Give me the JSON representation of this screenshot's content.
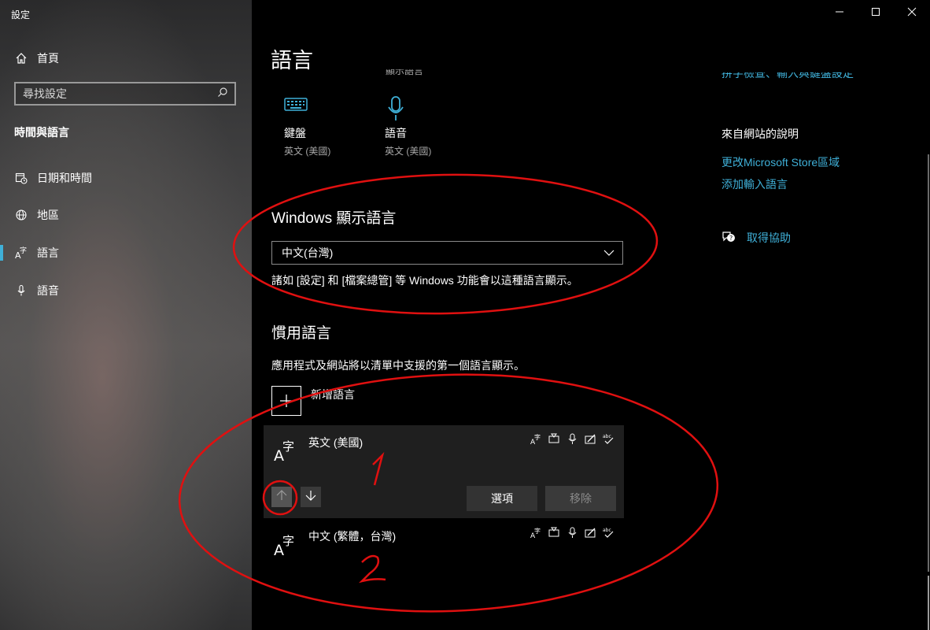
{
  "window": {
    "title": "設定"
  },
  "sidebar": {
    "home_label": "首頁",
    "search_placeholder": "尋找設定",
    "section_title": "時間與語言",
    "items": [
      {
        "label": "日期和時間",
        "icon": "calendar-clock-icon"
      },
      {
        "label": "地區",
        "icon": "globe-icon"
      },
      {
        "label": "語言",
        "icon": "language-icon",
        "active": true
      },
      {
        "label": "語音",
        "icon": "microphone-icon"
      }
    ]
  },
  "main": {
    "title": "語言",
    "cutoff_text": "顯示語言",
    "tiles": [
      {
        "name": "鍵盤",
        "sub": "英文 (美國)",
        "icon": "keyboard-icon"
      },
      {
        "name": "語音",
        "sub": "英文 (美國)",
        "icon": "microphone-icon"
      }
    ],
    "display_language": {
      "heading": "Windows 顯示語言",
      "selected": "中文(台灣)",
      "description": "諸如 [設定] 和 [檔案總管] 等 Windows 功能會以這種語言顯示。"
    },
    "preferred": {
      "heading": "慣用語言",
      "description": "應用程式及網站將以清單中支援的第一個語言顯示。",
      "add_label": "新增語言",
      "languages": [
        {
          "name": "英文 (美國)"
        },
        {
          "name": "中文 (繁體，台灣)"
        }
      ],
      "options_label": "選項",
      "remove_label": "移除"
    }
  },
  "right": {
    "top_link": "拼字檢查、輸入與鍵盤設定",
    "help_heading": "來自網站的說明",
    "links": [
      "更改Microsoft Store區域",
      "添加輸入語言"
    ],
    "help_label": "取得協助"
  },
  "annotations": {
    "mark_1": "1",
    "mark_2": "2",
    "color": "#e01010"
  },
  "colors": {
    "accent": "#3fb0d8",
    "annotation": "#e01010"
  }
}
